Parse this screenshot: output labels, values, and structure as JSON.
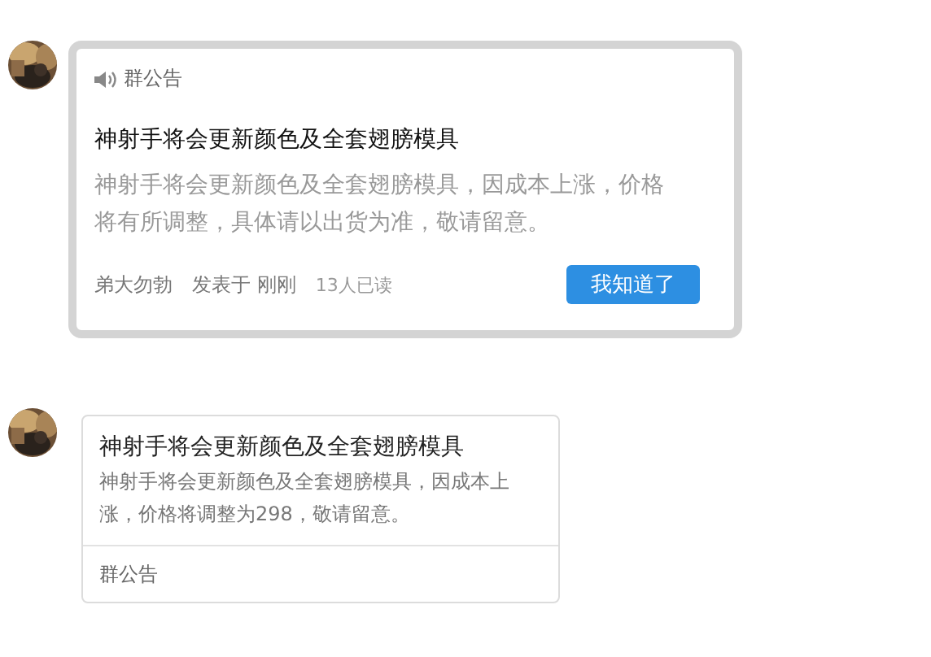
{
  "popup": {
    "header": "群公告",
    "title": "神射手将会更新颜色及全套翅膀模具",
    "body": "神射手将会更新颜色及全套翅膀模具，因成本上涨，价格将有所调整，具体请以出货为准，敬请留意。",
    "author": "弟大勿勃",
    "posted": "发表于 刚刚",
    "read_count": "13人已读",
    "button": "我知道了"
  },
  "card": {
    "title": "神射手将会更新颜色及全套翅膀模具",
    "body": "神射手将会更新颜色及全套翅膀模具，因成本上涨，价格将调整为298，敬请留意。",
    "footer": "群公告"
  }
}
